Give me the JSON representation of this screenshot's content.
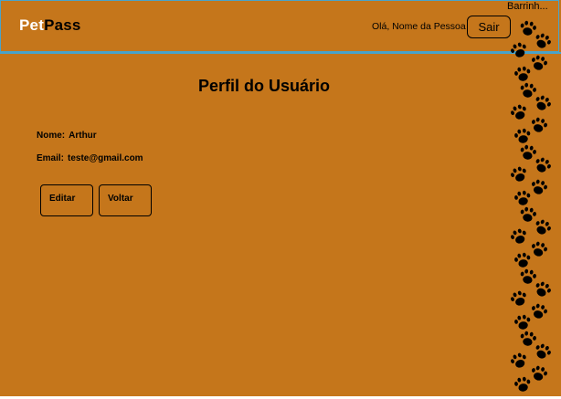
{
  "header": {
    "logo_part1": "Pet",
    "logo_part2": "Pass",
    "greeting": "Olá, Nome da Pessoa",
    "logout_label": "Sair",
    "sidebar_title": "Barrinh..."
  },
  "profile": {
    "title": "Perfil do Usuário",
    "name_label": "Nome:",
    "name_value": "Arthur",
    "email_label": "Email:",
    "email_value": "teste@gmail.com",
    "edit_label": "Editar",
    "back_label": "Voltar"
  },
  "decor": {
    "paw_icon": "paw-print-icon",
    "background_color": "#c5761b",
    "accent_color": "#4aa3c9"
  }
}
